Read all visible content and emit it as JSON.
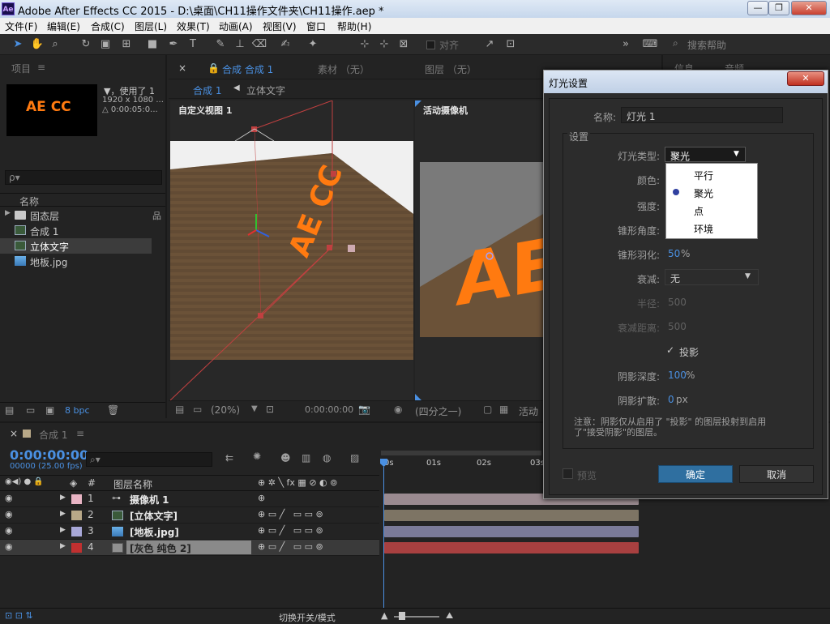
{
  "app": {
    "title": "Adobe After Effects CC 2015 - D:\\桌面\\CH11操作文件夹\\CH11操作.aep *",
    "icon": "Ae"
  },
  "menu": [
    "文件(F)",
    "编辑(E)",
    "合成(C)",
    "图层(L)",
    "效果(T)",
    "动画(A)",
    "视图(V)",
    "窗口",
    "帮助(H)"
  ],
  "toolbar": {
    "align_label": "对齐",
    "search_placeholder": "搜索帮助",
    "search_icon": "search-icon"
  },
  "project": {
    "tab": "项目",
    "thumb_text": "AE CC",
    "info": {
      "name": "▼，使用了 1",
      "size": "1920 x 1080 ...",
      "duration": "△ 0:00:05:0..."
    },
    "search_placeholder": "ρ▾",
    "col_name": "名称",
    "items": [
      {
        "name": "固态层",
        "type": "folder"
      },
      {
        "name": "合成 1",
        "type": "comp"
      },
      {
        "name": "立体文字",
        "type": "comp"
      },
      {
        "name": "地板.jpg",
        "type": "image"
      }
    ],
    "bpc": "8 bpc"
  },
  "viewer": {
    "tabs": [
      "合成 合成 1",
      "素材 （无）",
      "图层 （无）"
    ],
    "breadcrumb": [
      "合成 1",
      "立体文字"
    ],
    "left_view": "自定义视图 1",
    "right_view": "活动摄像机",
    "viewer_text": "AE CC",
    "zoom": "(20%)",
    "timecode": "0:00:00:00",
    "resolution": "(四分之一)",
    "camera": "活动"
  },
  "right_panel": {
    "tabs": [
      "信息",
      "音频"
    ]
  },
  "timeline": {
    "tab": "合成 1",
    "timecode": "0:00:00:00",
    "frames": "00000 (25.00 fps)",
    "col_num": "#",
    "col_name": "图层名称",
    "ruler": [
      "0s",
      "01s",
      "02s",
      "03s"
    ],
    "layers": [
      {
        "num": "1",
        "name": "摄像机 1",
        "color": "#e8b4c4",
        "track": "#9a8a90"
      },
      {
        "num": "2",
        "name": "[立体文字]",
        "color": "#b8a888",
        "track": "#7d7464"
      },
      {
        "num": "3",
        "name": "[地板.jpg]",
        "color": "#a8a8d8",
        "track": "#7a7a98"
      },
      {
        "num": "4",
        "name": "[灰色 纯色 2]",
        "color": "#c03030",
        "track": "#a84040"
      }
    ],
    "footer": "切换开关/模式"
  },
  "dialog": {
    "title": "灯光设置",
    "close": "✕",
    "name_label": "名称:",
    "name_value": "灯光 1",
    "group": "设置",
    "type_label": "灯光类型:",
    "type_value": "聚光",
    "type_options": [
      "平行",
      "聚光",
      "点",
      "环境"
    ],
    "color_label": "颜色:",
    "intensity_label": "强度:",
    "cone_label": "锥形角度:",
    "feather_label": "锥形羽化:",
    "feather_value": "50",
    "feather_unit": "%",
    "falloff_label": "衰减:",
    "falloff_value": "无",
    "radius_label": "半径:",
    "radius_value": "500",
    "falloff_dist_label": "衰减距离:",
    "falloff_dist_value": "500",
    "shadow_label": "投影",
    "shadow_depth_label": "阴影深度:",
    "shadow_depth_value": "100",
    "shadow_depth_unit": "%",
    "shadow_diffuse_label": "阴影扩散:",
    "shadow_diffuse_value": "0",
    "shadow_diffuse_unit": "px",
    "note": "注意：阴影仅从启用了 \"投影\" 的图层投射到启用了\"接受阴影\"的图层。",
    "preview_label": "预览",
    "ok": "确定",
    "cancel": "取消"
  }
}
